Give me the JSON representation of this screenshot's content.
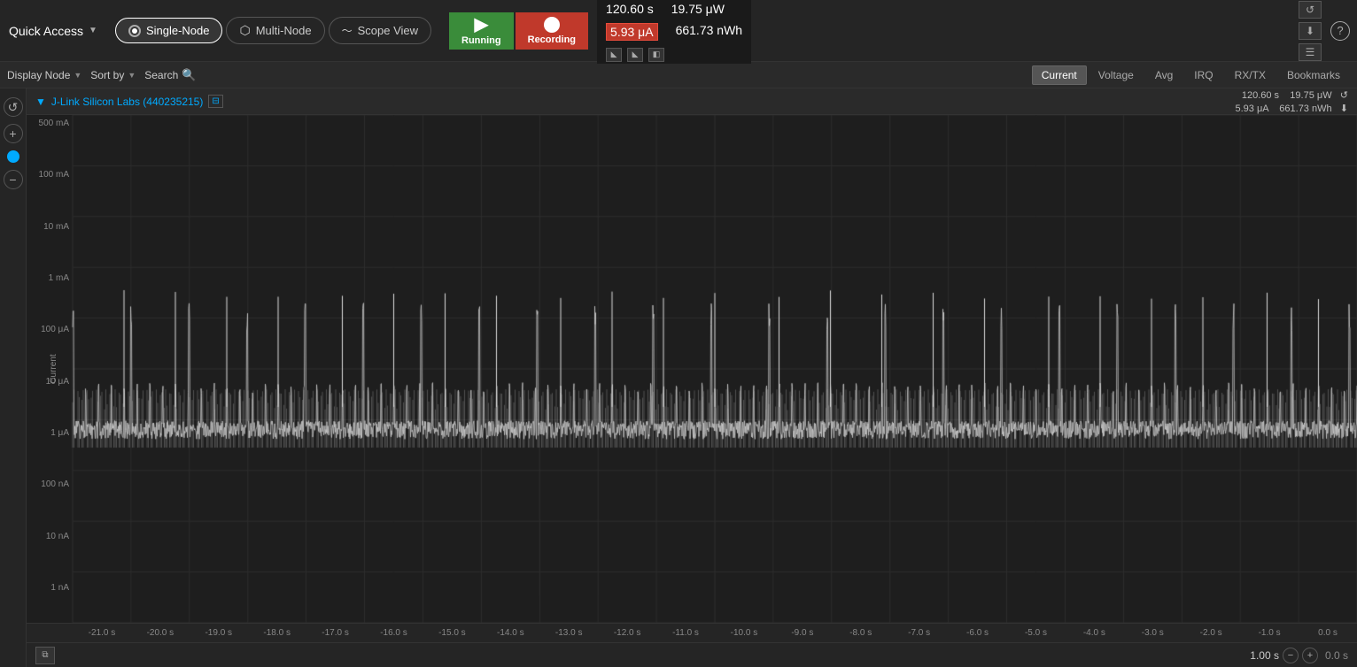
{
  "topbar": {
    "quick_access_label": "Quick Access",
    "modes": [
      {
        "id": "single-node",
        "label": "Single-Node",
        "active": true
      },
      {
        "id": "multi-node",
        "label": "Multi-Node",
        "active": false
      },
      {
        "id": "scope-view",
        "label": "Scope View",
        "active": false
      }
    ],
    "run_label": "Running",
    "record_label": "Recording",
    "stats": {
      "time": "120.60 s",
      "power": "19.75 μW",
      "current": "5.93 μA",
      "energy": "661.73 nWh"
    }
  },
  "toolbar": {
    "display_node_label": "Display Node",
    "sort_by_label": "Sort by",
    "search_label": "Search",
    "views": [
      "Current",
      "Voltage",
      "Avg",
      "IRQ",
      "RX/TX",
      "Bookmarks"
    ],
    "active_view": "Current"
  },
  "chart": {
    "device_label": "J-Link Silicon Labs (440235215)",
    "stats_right": {
      "time": "120.60 s",
      "power": "19.75 μW",
      "current": "5.93 μA",
      "energy": "661.73 nWh"
    },
    "y_axis_labels": [
      "500 mA",
      "100 mA",
      "10 mA",
      "1 mA",
      "100 μA",
      "10 μA",
      "1 μA",
      "100 nA",
      "10 nA",
      "1 nA"
    ],
    "x_axis_labels": [
      "-21.0 s",
      "-20.0 s",
      "-19.0 s",
      "-18.0 s",
      "-17.0 s",
      "-16.0 s",
      "-15.0 s",
      "-14.0 s",
      "-13.0 s",
      "-12.0 s",
      "-11.0 s",
      "-10.0 s",
      "-9.0 s",
      "-8.0 s",
      "-7.0 s",
      "-6.0 s",
      "-5.0 s",
      "-4.0 s",
      "-3.0 s",
      "-2.0 s",
      "-1.0 s",
      "0.0 s"
    ],
    "current_axis_label": "Current",
    "zoom_level": "1.00 s"
  }
}
